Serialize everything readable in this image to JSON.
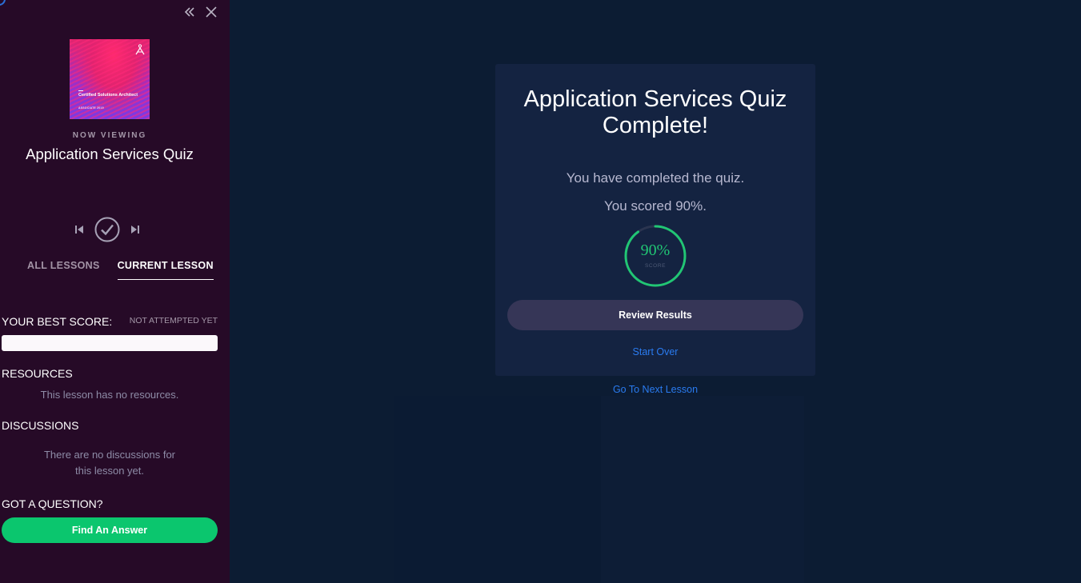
{
  "sidebar": {
    "course_thumbnail": {
      "title": "Certified Solutions Architect",
      "subtitle": "ASSOCIATE 2019"
    },
    "now_viewing_label": "NOW VIEWING",
    "lesson_title": "Application Services Quiz",
    "tabs": [
      {
        "label": "ALL LESSONS",
        "active": false
      },
      {
        "label": "CURRENT LESSON",
        "active": true
      }
    ],
    "best_score": {
      "label": "YOUR BEST SCORE:",
      "status": "NOT ATTEMPTED YET",
      "progress_fraction": 0.0
    },
    "resources": {
      "heading": "RESOURCES",
      "message": "This lesson has no resources."
    },
    "discussions": {
      "heading": "DISCUSSIONS",
      "message_line1": "There are no discussions for",
      "message_line2": "this lesson yet."
    },
    "question": {
      "heading": "GOT A QUESTION?",
      "button_label": "Find An Answer"
    }
  },
  "quiz_result": {
    "title_line1": "Application Services Quiz",
    "title_line2": "Complete!",
    "completed_text": "You have completed the quiz.",
    "score_text": "You scored 90%.",
    "score_percent": 90,
    "score_value_label": "90%",
    "score_caption": "SCORE",
    "review_button": "Review Results",
    "start_over": "Start Over",
    "next_lesson": "Go To Next Lesson"
  },
  "colors": {
    "sidebar_bg": "#260a27",
    "main_bg": "#0c1c33",
    "card_bg": "#142341",
    "accent_green": "#21c674",
    "link_blue": "#2a7bf0"
  },
  "icons": [
    "collapse-double-chevron-icon",
    "close-icon",
    "previous-icon",
    "complete-check-icon",
    "next-icon",
    "brand-logo-icon"
  ]
}
